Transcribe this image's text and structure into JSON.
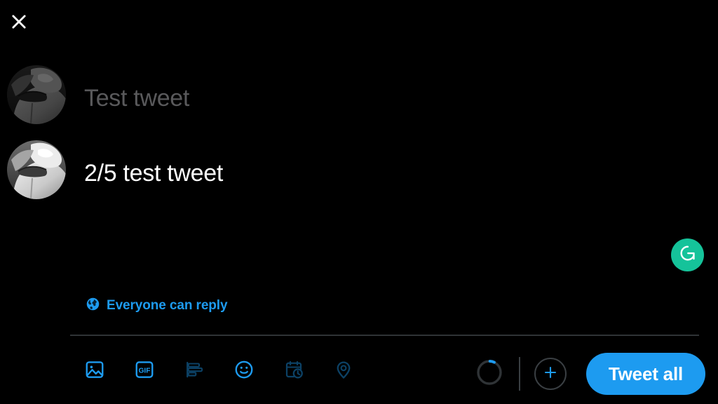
{
  "window": {
    "background_color": "#000000",
    "accent_color": "#1d9bf0"
  },
  "header": {
    "close_label": "Close",
    "close_icon": "close-icon"
  },
  "composer": {
    "tweets": [
      {
        "avatar_icon": "avatar-image",
        "text": "Test tweet",
        "state": "placeholder"
      },
      {
        "avatar_icon": "avatar-image",
        "text": "2/5 test tweet",
        "state": "active"
      }
    ]
  },
  "grammarly": {
    "label": "G",
    "icon": "grammarly-icon",
    "color": "#15c39a"
  },
  "reply_settings": {
    "icon": "globe-icon",
    "label": "Everyone can reply"
  },
  "toolbar": {
    "items": [
      {
        "icon": "image-icon",
        "label": "Add photos or video",
        "disabled": false
      },
      {
        "icon": "gif-icon",
        "label": "GIF",
        "disabled": false
      },
      {
        "icon": "poll-icon",
        "label": "Add poll",
        "disabled": true
      },
      {
        "icon": "emoji-icon",
        "label": "Add emoji",
        "disabled": false
      },
      {
        "icon": "schedule-icon",
        "label": "Schedule",
        "disabled": true
      },
      {
        "icon": "location-icon",
        "label": "Tag location",
        "disabled": true
      }
    ],
    "char_counter": {
      "icon": "progress-ring-icon",
      "percent": 6,
      "track_color": "#2f3336",
      "progress_color": "#1d9bf0"
    },
    "add_tweet": {
      "icon": "plus-icon",
      "label": "Add another Tweet"
    },
    "submit": {
      "label": "Tweet all",
      "color": "#1d9bf0"
    }
  }
}
